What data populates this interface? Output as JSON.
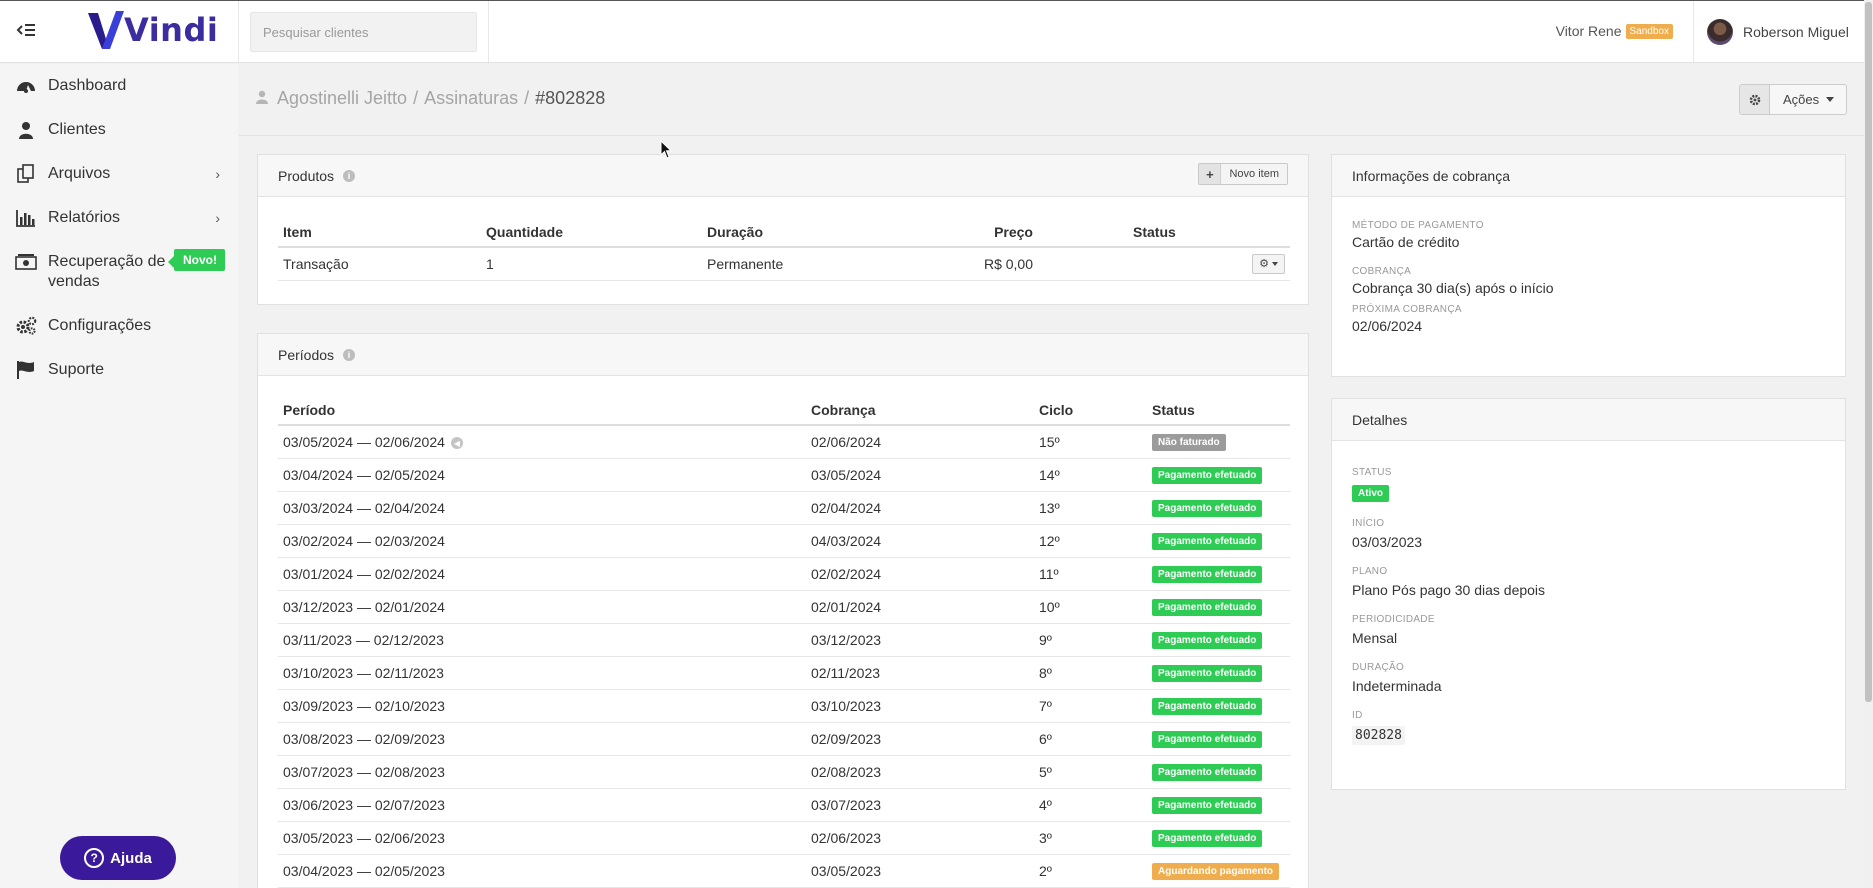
{
  "header": {
    "logo_text": "Vindi",
    "search_placeholder": "Pesquisar clientes",
    "account_name": "Vitor Rene",
    "account_badge": "Sandbox",
    "user_name": "Roberson Miguel"
  },
  "sidebar": {
    "items": [
      {
        "label": "Dashboard",
        "icon": "dashboard-icon"
      },
      {
        "label": "Clientes",
        "icon": "user-icon"
      },
      {
        "label": "Arquivos",
        "icon": "files-icon"
      },
      {
        "label": "Relatórios",
        "icon": "bar-chart-icon"
      },
      {
        "label": "Recuperação de vendas",
        "icon": "money-icon"
      },
      {
        "label": "Configurações",
        "icon": "gears-icon"
      },
      {
        "label": "Suporte",
        "icon": "flag-icon"
      }
    ],
    "novo_badge": "Novo!",
    "help_label": "Ajuda"
  },
  "breadcrumb": {
    "customer": "Agostinelli Jeitto",
    "section": "Assinaturas",
    "current": "#802828"
  },
  "actions_label": "Ações",
  "produtos": {
    "title": "Produtos",
    "new_item_label": "Novo item",
    "columns": [
      "Item",
      "Quantidade",
      "Duração",
      "Preço",
      "Status"
    ],
    "rows": [
      {
        "item": "Transação",
        "quantidade": "1",
        "duracao": "Permanente",
        "preco": "R$ 0,00",
        "status": ""
      }
    ]
  },
  "periodos": {
    "title": "Períodos",
    "columns": [
      "Período",
      "Cobrança",
      "Ciclo",
      "Status"
    ],
    "rows": [
      {
        "periodo": "03/05/2024 — 02/06/2024",
        "cobranca": "02/06/2024",
        "ciclo": "15º",
        "status": "Não faturado",
        "status_color": "#9b9b9b"
      },
      {
        "periodo": "03/04/2024 — 02/05/2024",
        "cobranca": "03/05/2024",
        "ciclo": "14º",
        "status": "Pagamento efetuado",
        "status_color": "#2ecc55"
      },
      {
        "periodo": "03/03/2024 — 02/04/2024",
        "cobranca": "02/04/2024",
        "ciclo": "13º",
        "status": "Pagamento efetuado",
        "status_color": "#2ecc55"
      },
      {
        "periodo": "03/02/2024 — 02/03/2024",
        "cobranca": "04/03/2024",
        "ciclo": "12º",
        "status": "Pagamento efetuado",
        "status_color": "#2ecc55"
      },
      {
        "periodo": "03/01/2024 — 02/02/2024",
        "cobranca": "02/02/2024",
        "ciclo": "11º",
        "status": "Pagamento efetuado",
        "status_color": "#2ecc55"
      },
      {
        "periodo": "03/12/2023 — 02/01/2024",
        "cobranca": "02/01/2024",
        "ciclo": "10º",
        "status": "Pagamento efetuado",
        "status_color": "#2ecc55"
      },
      {
        "periodo": "03/11/2023 — 02/12/2023",
        "cobranca": "03/12/2023",
        "ciclo": "9º",
        "status": "Pagamento efetuado",
        "status_color": "#2ecc55"
      },
      {
        "periodo": "03/10/2023 — 02/11/2023",
        "cobranca": "02/11/2023",
        "ciclo": "8º",
        "status": "Pagamento efetuado",
        "status_color": "#2ecc55"
      },
      {
        "periodo": "03/09/2023 — 02/10/2023",
        "cobranca": "03/10/2023",
        "ciclo": "7º",
        "status": "Pagamento efetuado",
        "status_color": "#2ecc55"
      },
      {
        "periodo": "03/08/2023 — 02/09/2023",
        "cobranca": "02/09/2023",
        "ciclo": "6º",
        "status": "Pagamento efetuado",
        "status_color": "#2ecc55"
      },
      {
        "periodo": "03/07/2023 — 02/08/2023",
        "cobranca": "02/08/2023",
        "ciclo": "5º",
        "status": "Pagamento efetuado",
        "status_color": "#2ecc55"
      },
      {
        "periodo": "03/06/2023 — 02/07/2023",
        "cobranca": "03/07/2023",
        "ciclo": "4º",
        "status": "Pagamento efetuado",
        "status_color": "#2ecc55"
      },
      {
        "periodo": "03/05/2023 — 02/06/2023",
        "cobranca": "02/06/2023",
        "ciclo": "3º",
        "status": "Pagamento efetuado",
        "status_color": "#2ecc55"
      },
      {
        "periodo": "03/04/2023 — 02/05/2023",
        "cobranca": "03/05/2023",
        "ciclo": "2º",
        "status": "Aguardando pagamento",
        "status_color": "#f0ad4e"
      }
    ]
  },
  "cobranca": {
    "title": "Informações de cobrança",
    "fields": [
      {
        "label": "Método de pagamento",
        "value": "Cartão de crédito"
      },
      {
        "label": "Cobrança",
        "value": "Cobrança 30 dia(s) após o início"
      },
      {
        "label": "Próxima cobrança",
        "value": "02/06/2024"
      }
    ]
  },
  "detalhes": {
    "title": "Detalhes",
    "status_label": "Status",
    "status_value": "Ativo",
    "fields": [
      {
        "label": "Início",
        "value": "03/03/2023"
      },
      {
        "label": "Plano",
        "value": "Plano Pós pago 30 dias depois"
      },
      {
        "label": "Periodicidade",
        "value": "Mensal"
      },
      {
        "label": "Duração",
        "value": "Indeterminada"
      }
    ],
    "id_label": "ID",
    "id_value": "802828"
  }
}
